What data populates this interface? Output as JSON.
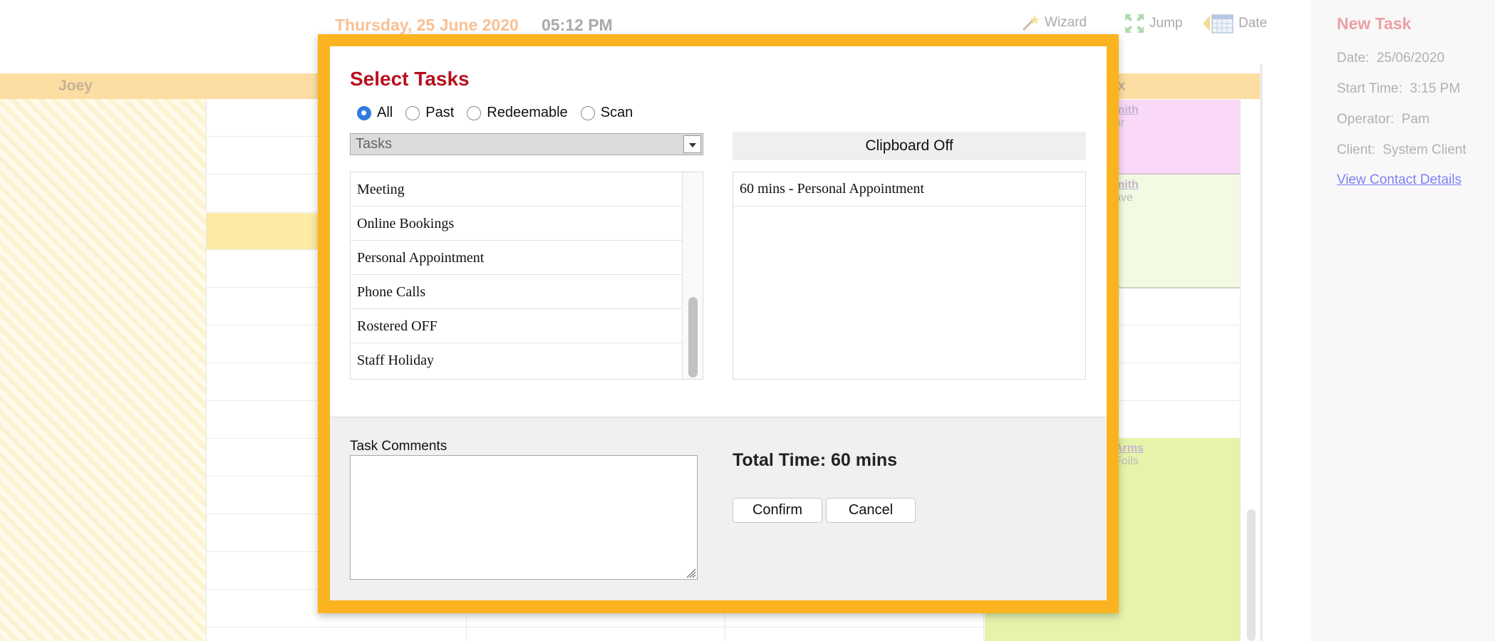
{
  "topbar": {
    "date": "Thursday, 25 June 2020",
    "time": "05:12 PM",
    "wizard_label": "Wizard",
    "jump_label": "Jump",
    "date_label": "Date"
  },
  "calendar": {
    "columns": [
      {
        "name": "Joey"
      },
      {
        "name": ""
      },
      {
        "name": ""
      },
      {
        "name": ""
      },
      {
        "name": "x"
      }
    ],
    "appointments": [
      {
        "name": "mith",
        "desc": "ur"
      },
      {
        "name": "mith",
        "desc": "ave"
      },
      {
        "name": "Arms",
        "desc": "Foils"
      }
    ]
  },
  "sidebar": {
    "title": "New Task",
    "date_label": "Date:",
    "date_value": "25/06/2020",
    "start_label": "Start Time:",
    "start_value": "3:15 PM",
    "operator_label": "Operator:",
    "operator_value": "Pam",
    "client_label": "Client:",
    "client_value": "System Client",
    "contact_link": "View Contact Details"
  },
  "modal": {
    "title": "Select Tasks",
    "filters": [
      "All",
      "Past",
      "Redeemable",
      "Scan"
    ],
    "selected_filter": "All",
    "category_select": "Tasks",
    "tasks": [
      "Meeting",
      "Online Bookings",
      "Personal Appointment",
      "Phone Calls",
      "Rostered OFF",
      "Staff Holiday"
    ],
    "clipboard_header": "Clipboard Off",
    "clipboard_items": [
      "60 mins - Personal Appointment"
    ],
    "comments_label": "Task Comments",
    "comments_value": "",
    "total_time": "Total Time: 60 mins",
    "confirm_label": "Confirm",
    "cancel_label": "Cancel"
  },
  "colors": {
    "modal_border": "#fbb41f",
    "title_red": "#b8101f",
    "accent_blue": "#2f7de1",
    "column_header": "#fbbf4a"
  }
}
